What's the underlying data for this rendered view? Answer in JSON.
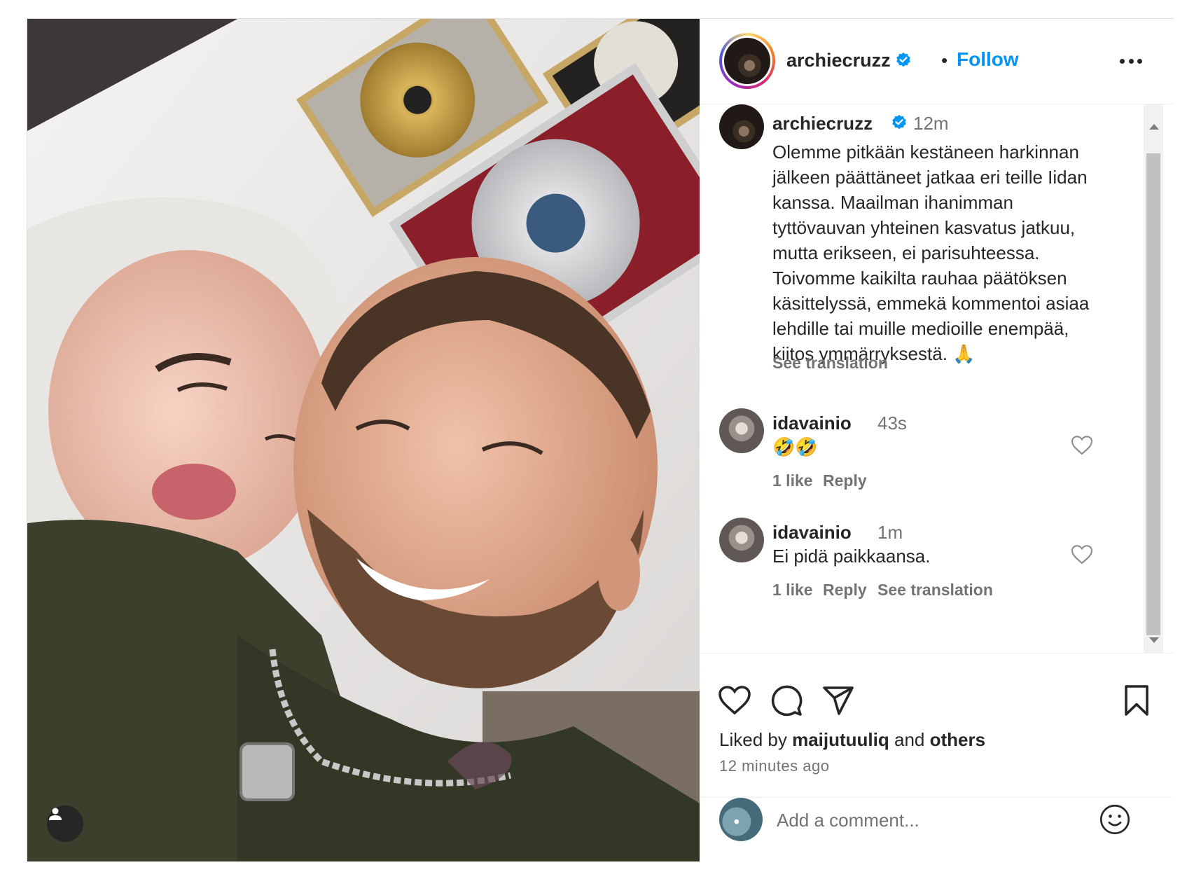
{
  "post": {
    "username": "archiecruzz",
    "follow_label": "Follow",
    "separator": "•"
  },
  "caption": {
    "username": "archiecruzz",
    "time": "12m",
    "text": "Olemme pitkään kestäneen harkinnan jälkeen päättäneet jatkaa eri teille Iidan kanssa. Maailman ihanimman tyttövauvan yhteinen kasvatus jatkuu, mutta erikseen, ei parisuhteessa. Toivomme kaikilta rauhaa päätöksen käsittelyssä, emmekä kommentoi asiaa lehdille tai muille medioille enempää, kiitos ymmärryksestä. 🙏",
    "see_translation": "See translation"
  },
  "comments": [
    {
      "username": "idavainio",
      "time": "43s",
      "text": "🤣🤣",
      "likes": "1 like",
      "reply": "Reply"
    },
    {
      "username": "idavainio",
      "time": "1m",
      "text": "Ei pidä paikkaansa.",
      "likes": "1 like",
      "reply": "Reply",
      "see_translation": "See translation"
    }
  ],
  "likes": {
    "prefix": "Liked by",
    "user": "maijutuuliq",
    "joiner": "and",
    "others": "others"
  },
  "timestamp": "12 minutes ago",
  "composer": {
    "placeholder": "Add a comment..."
  },
  "icons": [
    "more-icon",
    "verified-icon",
    "heart-icon",
    "comment-icon",
    "share-icon",
    "bookmark-icon",
    "emoji-icon",
    "tag-person-icon"
  ],
  "colors": {
    "accent": "#0095f6",
    "text": "#262626",
    "muted": "#737373",
    "verified": "#0095f6"
  }
}
